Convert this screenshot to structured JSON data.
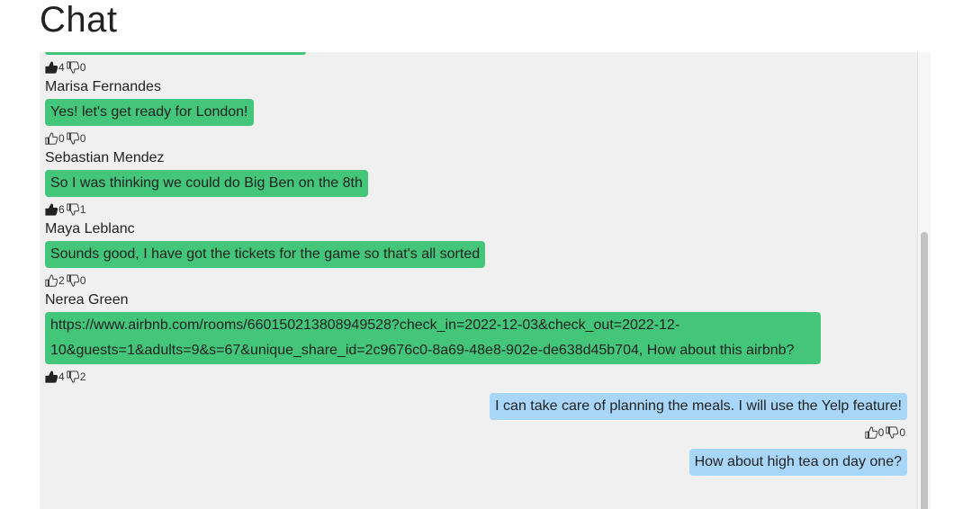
{
  "page": {
    "title": "Chat"
  },
  "top_reactions": {
    "likes": "4",
    "dislikes": "0",
    "liked": true
  },
  "messages": [
    {
      "sender": "Marisa Fernandes",
      "text": "Yes! let's get ready for London!",
      "likes": "0",
      "dislikes": "0",
      "liked": false,
      "side": "left"
    },
    {
      "sender": "Sebastian Mendez",
      "text": "So I was thinking we could do Big Ben on the 8th",
      "likes": "6",
      "dislikes": "1",
      "liked": true,
      "side": "left"
    },
    {
      "sender": "Maya Leblanc",
      "text": "Sounds good, I have got the tickets for the game so that's all sorted",
      "likes": "2",
      "dislikes": "0",
      "liked": false,
      "side": "left"
    },
    {
      "sender": "Nerea Green",
      "text": "https://www.airbnb.com/rooms/660150213808949528?check_in=2022-12-03&check_out=2022-12-10&guests=1&adults=9&s=67&unique_share_id=2c9676c0-8a69-48e8-902e-de638d45b704, How about this airbnb?",
      "likes": "4",
      "dislikes": "2",
      "liked": true,
      "side": "left"
    },
    {
      "sender": "",
      "text": "I can take care of planning the meals. I will use the Yelp feature!",
      "likes": "0",
      "dislikes": "0",
      "liked": false,
      "side": "right"
    },
    {
      "sender": "",
      "text": "How about high tea on day one?",
      "likes": "",
      "dislikes": "",
      "liked": false,
      "side": "right"
    }
  ],
  "colors": {
    "incoming_bubble": "#43c67a",
    "outgoing_bubble": "#a8d6f8",
    "panel_bg": "#f0f0f0"
  },
  "icons": {
    "like": "thumbs-up-icon",
    "dislike": "thumbs-down-icon"
  }
}
